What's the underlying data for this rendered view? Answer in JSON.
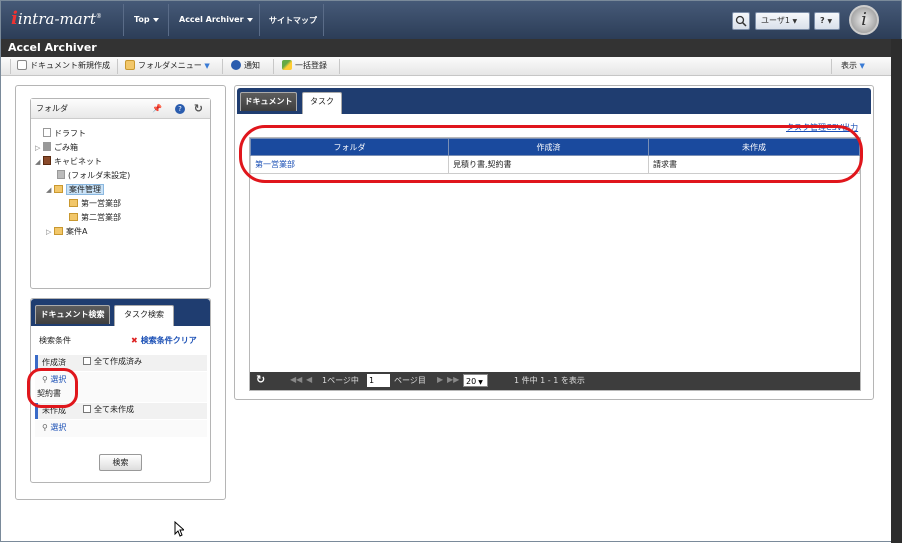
{
  "topnav": {
    "logo": "intra-mart",
    "logo_mark": "®",
    "top": "Top",
    "accel": "Accel Archiver",
    "sitemap": "サイトマップ",
    "user": "ユーザ1",
    "help": "?"
  },
  "app_title": "Accel Archiver",
  "toolbar": {
    "new_doc": "ドキュメント新規作成",
    "folder_menu": "フォルダメニュー",
    "notify": "通知",
    "bulk": "一括登録",
    "view": "表示"
  },
  "folder_panel": {
    "title": "フォルダ",
    "tree": [
      "ドラフト",
      "ごみ箱",
      "キャビネット",
      "(フォルダ未設定)",
      "案件管理",
      "第一営業部",
      "第二営業部",
      "案件A"
    ]
  },
  "search_panel": {
    "tab_doc": "ドキュメント検索",
    "tab_task": "タスク検索",
    "cond_label": "検索条件",
    "clear": "検索条件クリア",
    "created_label": "作成済",
    "created_all": "全て作成済み",
    "select1": "選択",
    "value1": "契約書",
    "notcreated_label": "未作成",
    "notcreated_all": "全て未作成",
    "select2": "選択",
    "search_btn": "検索"
  },
  "main": {
    "tab_doc": "ドキュメント",
    "tab_task": "タスク",
    "csv": "タスク管理CSV出力",
    "columns": [
      "フォルダ",
      "作成済",
      "未作成"
    ],
    "rows": [
      [
        "第一営業部",
        "見積り書,契約書",
        "請求書"
      ]
    ],
    "pager": {
      "page_prefix": "1ページ中",
      "page": "1",
      "page_suffix": "ページ目",
      "size": "20",
      "info": "1 件中 1 - 1 を表示"
    }
  }
}
